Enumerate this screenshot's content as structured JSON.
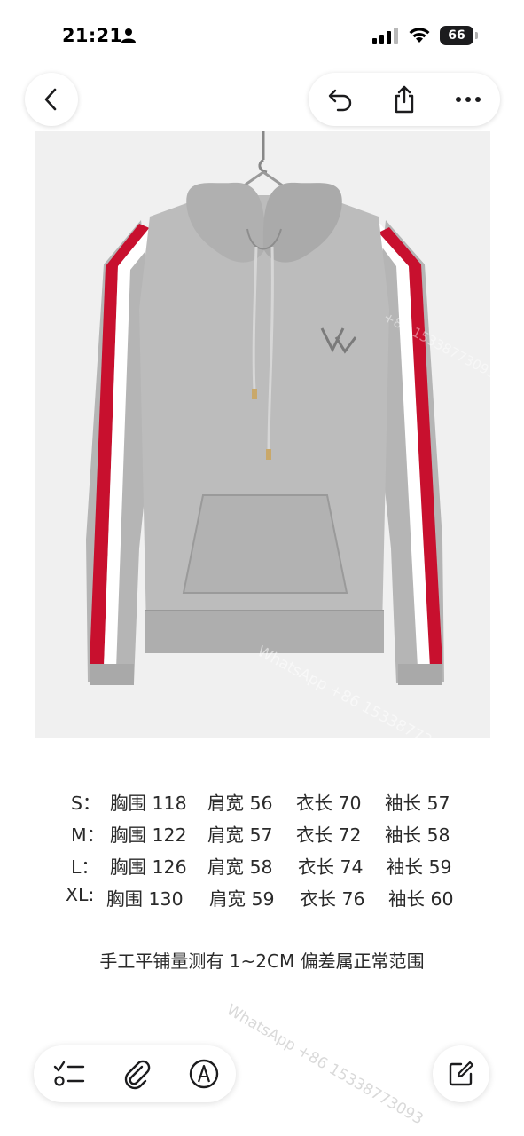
{
  "status_bar": {
    "time": "21:21",
    "battery": "66"
  },
  "toolbar": {
    "back_icon": "chevron-left-icon",
    "undo_icon": "undo-icon",
    "share_icon": "share-icon",
    "more_icon": "ellipsis-icon"
  },
  "photo": {
    "subject": "grey hoodie with red and white sleeve stripes on hanger",
    "colors": {
      "hoodie": "#b5b5b5",
      "stripe_red": "#c8102e",
      "stripe_white": "#ffffff",
      "background": "#f0f0f0"
    }
  },
  "size_table": [
    {
      "size": "S：",
      "chest": "胸围 118",
      "shoulder": "肩宽 56",
      "length": "衣长 70",
      "sleeve": "袖长 57"
    },
    {
      "size": "M：",
      "chest": "胸围 122",
      "shoulder": "肩宽 57",
      "length": "衣长 72",
      "sleeve": "袖长 58"
    },
    {
      "size": "L：",
      "chest": "胸围 126",
      "shoulder": "肩宽 58",
      "length": "衣长 74",
      "sleeve": "袖长 59"
    },
    {
      "size": "XL:",
      "chest": "胸围 130",
      "shoulder": "肩宽 59",
      "length": "衣长 76",
      "sleeve": "袖长 60"
    }
  ],
  "note": "手工平铺量测有 1~2CM 偏差属正常范围",
  "watermarks": {
    "bottom": "WhatsApp +86 15338773093",
    "photo": "WhatsApp +86 15338773093",
    "photo_upper": "+86 15338773093"
  },
  "bottom_bar": {
    "checklist_icon": "checklist-icon",
    "attach_icon": "paperclip-icon",
    "markup_icon": "markup-pen-icon",
    "compose_icon": "compose-icon"
  }
}
